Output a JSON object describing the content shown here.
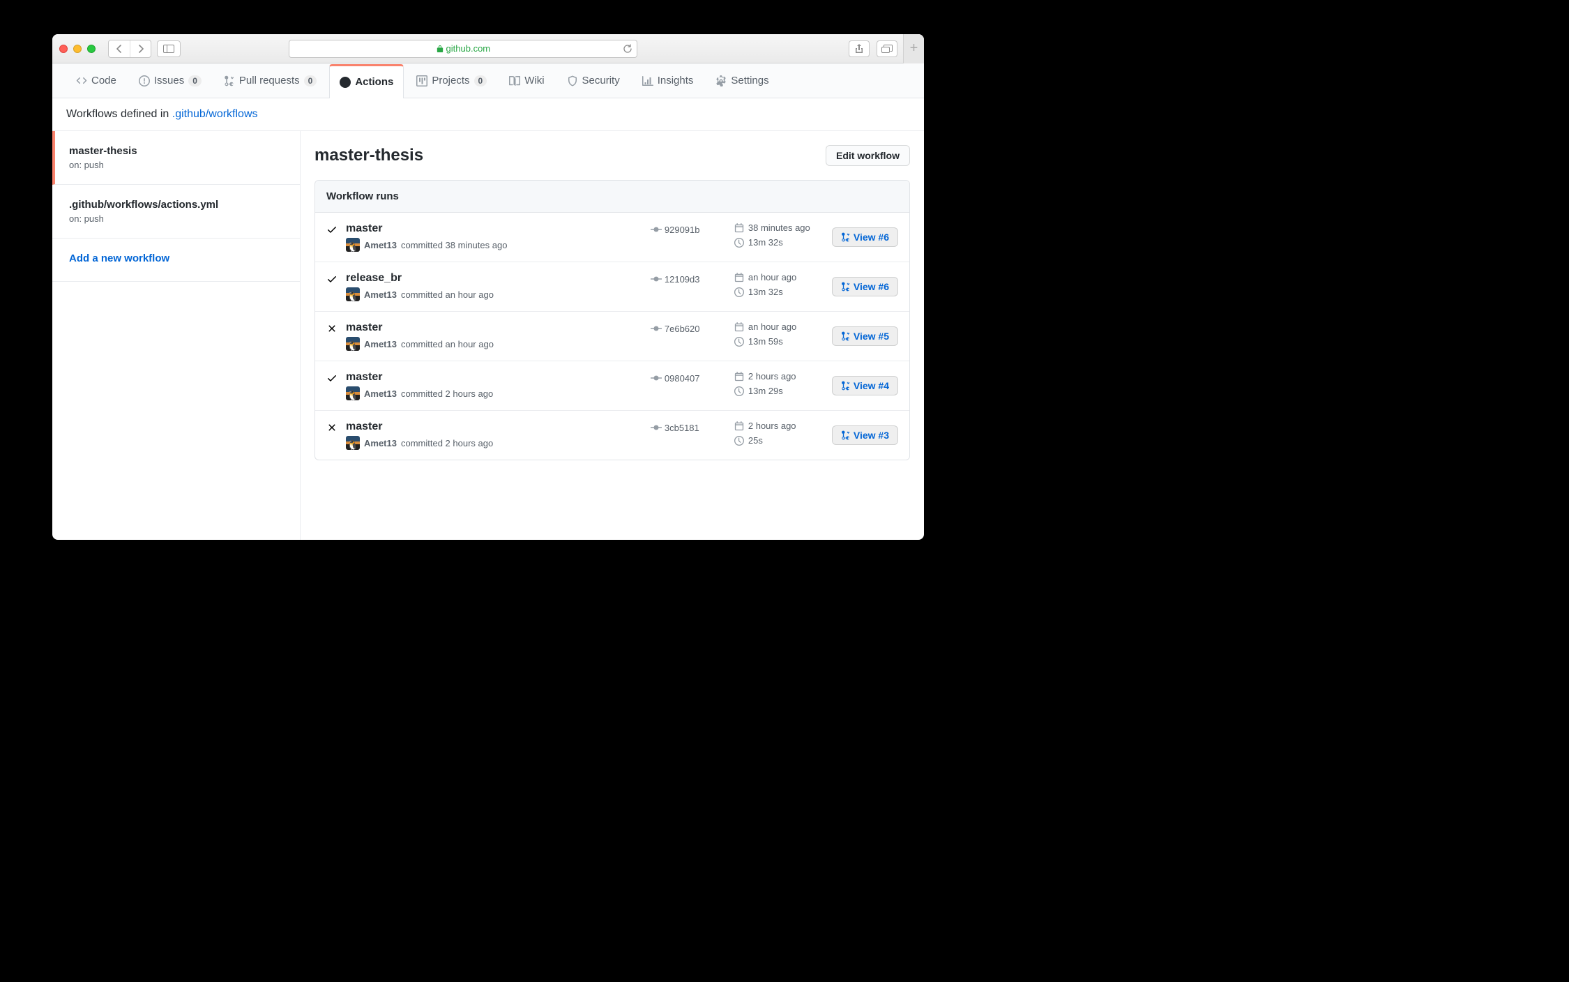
{
  "browser": {
    "domain": "github.com"
  },
  "repo_tabs": {
    "code": "Code",
    "issues": {
      "label": "Issues",
      "count": "0"
    },
    "pulls": {
      "label": "Pull requests",
      "count": "0"
    },
    "actions": "Actions",
    "projects": {
      "label": "Projects",
      "count": "0"
    },
    "wiki": "Wiki",
    "security": "Security",
    "insights": "Insights",
    "settings": "Settings"
  },
  "subhead": {
    "prefix": "Workflows defined in ",
    "link": ".github/workflows"
  },
  "sidebar": {
    "items": [
      {
        "name": "master-thesis",
        "trigger": "on: push"
      },
      {
        "name": ".github/workflows/actions.yml",
        "trigger": "on: push"
      }
    ],
    "add_link": "Add a new workflow"
  },
  "main": {
    "title": "master-thesis",
    "edit_btn": "Edit workflow",
    "runs_header": "Workflow runs",
    "runs": [
      {
        "status": "success",
        "branch": "master",
        "author": "Amet13",
        "committed": "committed 38 minutes ago",
        "sha": "929091b",
        "when": "38 minutes ago",
        "duration": "13m 32s",
        "view": "View #6"
      },
      {
        "status": "success",
        "branch": "release_br",
        "author": "Amet13",
        "committed": "committed an hour ago",
        "sha": "12109d3",
        "when": "an hour ago",
        "duration": "13m 32s",
        "view": "View #6"
      },
      {
        "status": "failure",
        "branch": "master",
        "author": "Amet13",
        "committed": "committed an hour ago",
        "sha": "7e6b620",
        "when": "an hour ago",
        "duration": "13m 59s",
        "view": "View #5"
      },
      {
        "status": "success",
        "branch": "master",
        "author": "Amet13",
        "committed": "committed 2 hours ago",
        "sha": "0980407",
        "when": "2 hours ago",
        "duration": "13m 29s",
        "view": "View #4"
      },
      {
        "status": "failure",
        "branch": "master",
        "author": "Amet13",
        "committed": "committed 2 hours ago",
        "sha": "3cb5181",
        "when": "2 hours ago",
        "duration": "25s",
        "view": "View #3"
      }
    ]
  }
}
